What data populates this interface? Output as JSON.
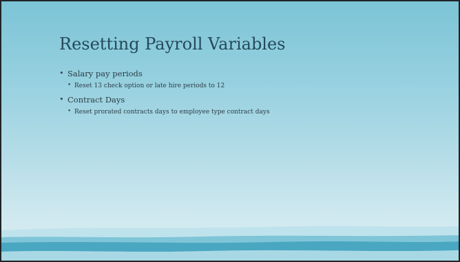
{
  "slide": {
    "title": "Resetting Payroll Variables",
    "bullets": [
      {
        "text": "Salary pay periods",
        "sub": [
          "Reset 13 check option or late hire periods to 12"
        ]
      },
      {
        "text": "Contract Days",
        "sub": [
          "Reset prorated contracts days to employee type contract days"
        ]
      }
    ]
  },
  "theme": {
    "background_top": "#7cc4d6",
    "background_bottom": "#d9edf3",
    "wave_dark": "#4aa7c1",
    "wave_light": "#a9d8e5",
    "title_color": "#24495a",
    "text_color": "#2b3c44"
  }
}
